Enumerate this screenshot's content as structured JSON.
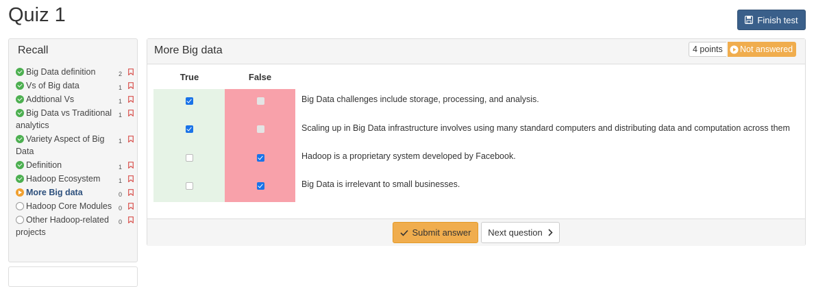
{
  "page": {
    "title": "Quiz 1"
  },
  "toolbar": {
    "finish_label": "Finish test",
    "finish_icon": "save-icon"
  },
  "sidebar": {
    "title": "Recall",
    "items": [
      {
        "label": "Big Data definition",
        "count": "2",
        "status": "done"
      },
      {
        "label": "Vs of Big data",
        "count": "1",
        "status": "done"
      },
      {
        "label": "Addtional Vs",
        "count": "1",
        "status": "done"
      },
      {
        "label": "Big Data vs Traditional analytics",
        "count": "1",
        "status": "done"
      },
      {
        "label": "Variety Aspect of Big Data",
        "count": "1",
        "status": "done"
      },
      {
        "label": "Definition",
        "count": "1",
        "status": "done"
      },
      {
        "label": "Hadoop Ecosystem",
        "count": "1",
        "status": "done"
      },
      {
        "label": "More Big data",
        "count": "0",
        "status": "current"
      },
      {
        "label": "Hadoop Core Modules",
        "count": "0",
        "status": "empty"
      },
      {
        "label": "Other Hadoop-related projects",
        "count": "0",
        "status": "empty"
      }
    ]
  },
  "question": {
    "title": "More Big data",
    "points": "4 points",
    "status": "Not answered",
    "col_true": "True",
    "col_false": "False",
    "rows": [
      {
        "text": "Big Data challenges include storage, processing, and analysis.",
        "true": "checked",
        "false": "disabled"
      },
      {
        "text": "Scaling up in Big Data infrastructure involves using many standard computers and distributing data and computation across them",
        "true": "checked",
        "false": "disabled"
      },
      {
        "text": "Hadoop is a proprietary system developed by Facebook.",
        "true": "unchecked",
        "false": "checked"
      },
      {
        "text": "Big Data is irrelevant to small businesses.",
        "true": "unchecked",
        "false": "checked"
      }
    ],
    "submit_label": "Submit answer",
    "next_label": "Next question"
  },
  "colors": {
    "accent": "#3a5f8a",
    "warning": "#f0ad4e",
    "success": "#4caf50",
    "true_bg": "#e6f3e6",
    "false_bg": "#f8a1aa"
  }
}
